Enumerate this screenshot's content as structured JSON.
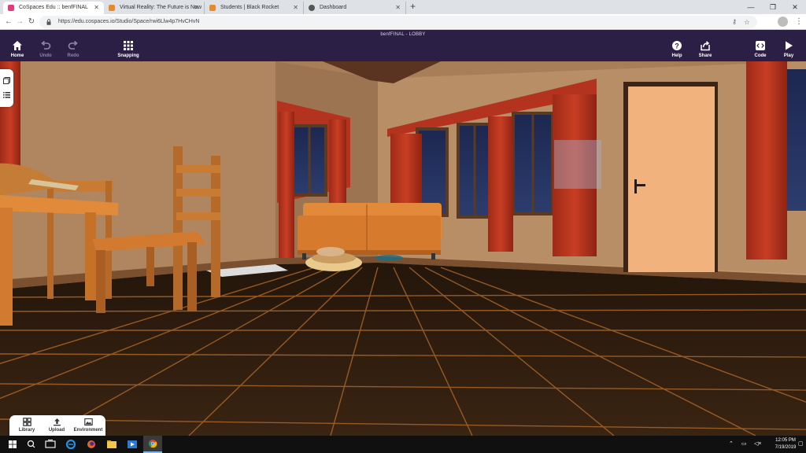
{
  "browser": {
    "tabs": [
      {
        "title": "CoSpaces Edu :: benfFINAL",
        "favicon_color": "#e23a7c"
      },
      {
        "title": "Virtual Reality: The Future is Now",
        "favicon_color": "#e8892c"
      },
      {
        "title": "Students | Black Rocket",
        "favicon_color": "#e8892c"
      },
      {
        "title": "Dashboard",
        "favicon_color": "#555555"
      }
    ],
    "url": "https://edu.cospaces.io/Studio/Space/rwi6Llw4p7HvCHvN"
  },
  "app": {
    "space_title": "benfFINAL - LOBBY",
    "toolbar": {
      "home": "Home",
      "undo": "Undo",
      "redo": "Redo",
      "snapping": "Snapping",
      "help": "Help",
      "share": "Share",
      "code": "Code",
      "play": "Play"
    },
    "bottom_panel": {
      "library": "Library",
      "upload": "Upload",
      "environment": "Environment"
    },
    "colors": {
      "toolbar_bg": "#2b1f45",
      "wall": "#b98d63",
      "floor": "#2a1a0d",
      "curtain": "#b3331f",
      "sofa": "#e3893a",
      "door": "#f1b27e"
    }
  },
  "taskbar": {
    "time": "12:05 PM",
    "date": "7/19/2019"
  }
}
